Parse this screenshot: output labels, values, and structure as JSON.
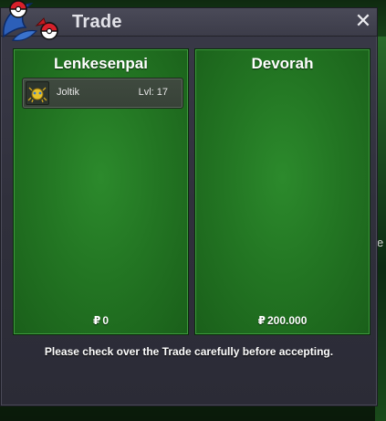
{
  "window": {
    "title": "Trade",
    "close_glyph": "✕"
  },
  "left_panel": {
    "player_name": "Lenkesenpai",
    "items": [
      {
        "icon": "joltik-sprite-icon",
        "name": "Joltik",
        "level": "Lvl: 17"
      }
    ],
    "currency_symbol": "₽",
    "money": "0"
  },
  "right_panel": {
    "player_name": "Devorah",
    "items": [],
    "currency_symbol": "₽",
    "money": "200.000"
  },
  "notice": "Please check over the Trade carefully before accepting.",
  "background": {
    "edge_text": "e"
  },
  "colors": {
    "panel_green": "#237623",
    "window_bg": "#30303c",
    "text": "#ffffff"
  }
}
